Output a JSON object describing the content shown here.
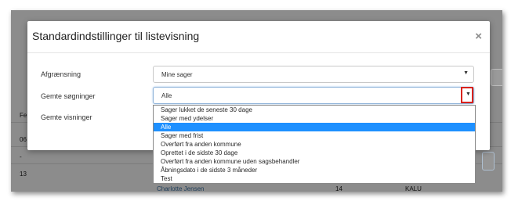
{
  "dialog": {
    "title": "Standardindstillinger til listevisning",
    "close_symbol": "×"
  },
  "form": {
    "afgraensning_label": "Afgrænsning",
    "afgraensning_value": "Mine sager",
    "gemte_soegninger_label": "Gemte søgninger",
    "gemte_soegninger_value": "Alle",
    "gemte_visninger_label": "Gemte visninger",
    "caret": "▼"
  },
  "dropdown_options": [
    "Sager lukket de seneste 30 dage",
    "Sager med ydelser",
    "Alle",
    "Sager med frist",
    "Overført fra anden kommune",
    "Oprettet i de sidste 30 dage",
    "Overført fra anden kommune uden sagsbehandler",
    "Åbningsdato i de sidste 3 måneder",
    "Test"
  ],
  "dropdown_selected": "Alle",
  "background": {
    "col_label_fragment": "Fe",
    "row1_fragment": "06",
    "row2_fragment": "-",
    "row3_fragment": "13",
    "name_link": "Charlotte Jensen",
    "number": "14",
    "code": "KALU"
  },
  "colors": {
    "highlight": "#1e90ff",
    "red_outline": "#d9231d",
    "overlay": "#8c8c8c"
  }
}
